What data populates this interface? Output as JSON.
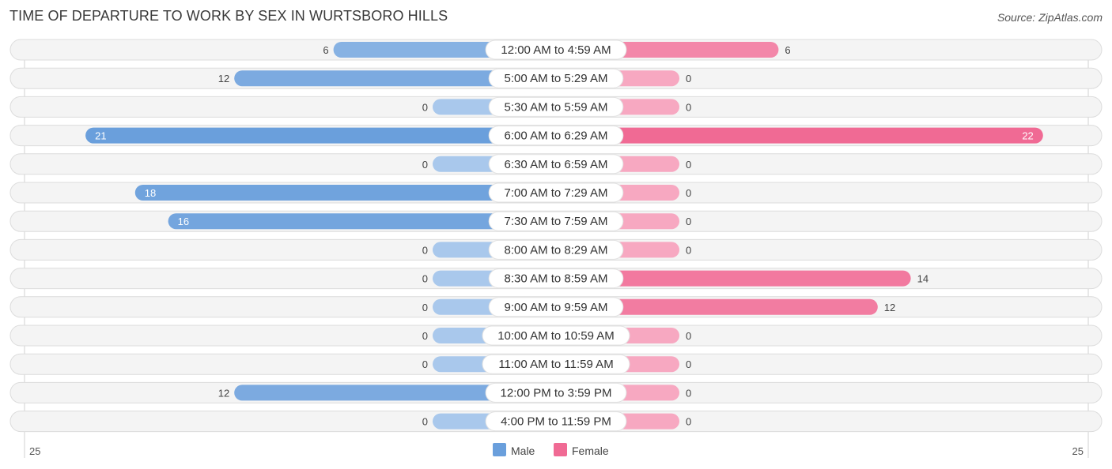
{
  "header": {
    "title": "TIME OF DEPARTURE TO WORK BY SEX IN WURTSBORO HILLS",
    "source": "Source: ZipAtlas.com"
  },
  "chart_data": {
    "type": "bar",
    "orientation": "horizontal-diverging",
    "title": "TIME OF DEPARTURE TO WORK BY SEX IN WURTSBORO HILLS",
    "categories": [
      "12:00 AM to 4:59 AM",
      "5:00 AM to 5:29 AM",
      "5:30 AM to 5:59 AM",
      "6:00 AM to 6:29 AM",
      "6:30 AM to 6:59 AM",
      "7:00 AM to 7:29 AM",
      "7:30 AM to 7:59 AM",
      "8:00 AM to 8:29 AM",
      "8:30 AM to 8:59 AM",
      "9:00 AM to 9:59 AM",
      "10:00 AM to 10:59 AM",
      "11:00 AM to 11:59 AM",
      "12:00 PM to 3:59 PM",
      "4:00 PM to 11:59 PM"
    ],
    "series": [
      {
        "name": "Male",
        "color": "#6a9fdc",
        "light_color": "#a9c8ec",
        "values": [
          6,
          12,
          0,
          21,
          0,
          18,
          16,
          0,
          0,
          0,
          0,
          0,
          12,
          0
        ]
      },
      {
        "name": "Female",
        "color": "#f06a94",
        "light_color": "#f7a8c1",
        "values": [
          6,
          0,
          0,
          22,
          0,
          0,
          0,
          0,
          14,
          12,
          0,
          0,
          0,
          0
        ]
      }
    ],
    "axis": {
      "left_tick": "25",
      "right_tick": "25",
      "max": 25
    },
    "legend": {
      "placement": "bottom-center",
      "items": [
        "Male",
        "Female"
      ]
    },
    "xlabel": "",
    "ylabel": ""
  }
}
